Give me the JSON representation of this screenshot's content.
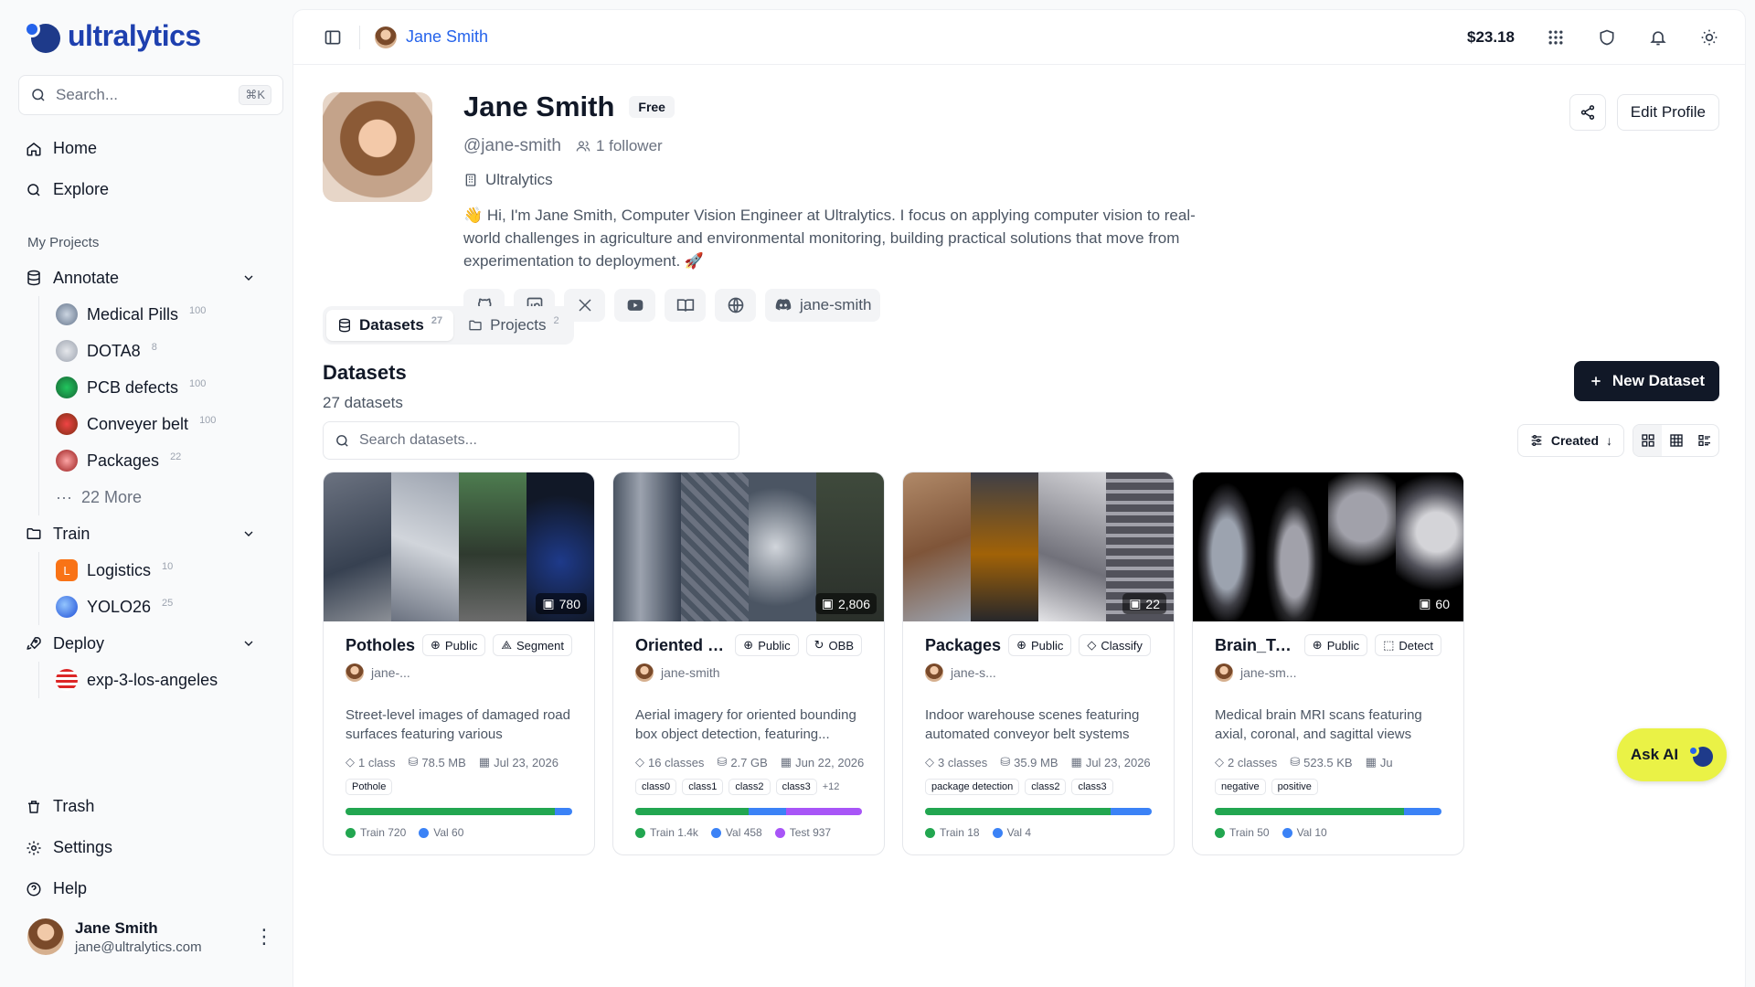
{
  "app": {
    "logo_text": "ultralytics",
    "brand_color": "#1e40af",
    "accent_color": "#2563eb"
  },
  "sidebar": {
    "search_placeholder": "Search...",
    "search_shortcut": "⌘K",
    "nav": [
      {
        "label": "Home",
        "icon": "home-icon"
      },
      {
        "label": "Explore",
        "icon": "search-icon"
      }
    ],
    "section_label": "My Projects",
    "groups": [
      {
        "label": "Annotate",
        "icon": "database-icon",
        "items": [
          {
            "label": "Medical Pills",
            "count": "100"
          },
          {
            "label": "DOTA8",
            "count": "8"
          },
          {
            "label": "PCB defects",
            "count": "100"
          },
          {
            "label": "Conveyer belt",
            "count": "100"
          },
          {
            "label": "Packages",
            "count": "22"
          }
        ],
        "more": "22 More"
      },
      {
        "label": "Train",
        "icon": "folder-icon",
        "items": [
          {
            "label": "Logistics",
            "count": "10"
          },
          {
            "label": "YOLO26",
            "count": "25"
          }
        ]
      },
      {
        "label": "Deploy",
        "icon": "rocket-icon",
        "items": [
          {
            "label": "exp-3-los-angeles",
            "count": ""
          }
        ]
      }
    ],
    "bottom": [
      {
        "label": "Trash"
      },
      {
        "label": "Settings"
      },
      {
        "label": "Help"
      }
    ],
    "user": {
      "name": "Jane Smith",
      "email": "jane@ultralytics.com"
    }
  },
  "topbar": {
    "crumb": "Jane Smith",
    "credit": "$23.18"
  },
  "profile": {
    "name": "Jane Smith",
    "plan": "Free",
    "handle": "@jane-smith",
    "followers": "1 follower",
    "org": "Ultralytics",
    "bio": "👋 Hi, I'm Jane Smith, Computer Vision Engineer at Ultralytics. I focus on applying computer vision to real-world challenges in agriculture and environmental monitoring, building practical solutions that move from experimentation to deployment. 🚀",
    "discord": "jane-smith",
    "edit_label": "Edit Profile"
  },
  "tabs": [
    {
      "label": "Datasets",
      "count": "27"
    },
    {
      "label": "Projects",
      "count": "2"
    }
  ],
  "datasets": {
    "title": "Datasets",
    "count": "27 datasets",
    "new_label": "New Dataset",
    "search_placeholder": "Search datasets...",
    "sort_label": "Created",
    "cards": [
      {
        "title": "Potholes",
        "visibility": "Public",
        "task": "Segment",
        "owner": "jane-...",
        "image_count": "780",
        "desc": "Street-level images of damaged road surfaces featuring various potholes,...",
        "classes_n": "1 class",
        "size": "78.5 MB",
        "date": "Jul 23, 2026",
        "classes": [
          "Pothole"
        ],
        "more": "",
        "legend": [
          {
            "label": "Train 720",
            "color": "#22a650"
          },
          {
            "label": "Val 60",
            "color": "#3b82f6"
          }
        ],
        "split": [
          720,
          60,
          0
        ]
      },
      {
        "title": "Oriented B...",
        "visibility": "Public",
        "task": "OBB",
        "owner": "jane-smith",
        "image_count": "2,806",
        "desc": "Aerial imagery for oriented bounding box object detection, featuring...",
        "classes_n": "16 classes",
        "size": "2.7 GB",
        "date": "Jun 22, 2026",
        "classes": [
          "class0",
          "class1",
          "class2",
          "class3"
        ],
        "more": "+12",
        "legend": [
          {
            "label": "Train 1.4k",
            "color": "#22a650"
          },
          {
            "label": "Val 458",
            "color": "#3b82f6"
          },
          {
            "label": "Test 937",
            "color": "#a855f7"
          }
        ],
        "split": [
          1400,
          458,
          937
        ]
      },
      {
        "title": "Packages",
        "visibility": "Public",
        "task": "Classify",
        "owner": "jane-s...",
        "image_count": "22",
        "desc": "Indoor warehouse scenes featuring automated conveyor belt systems fo...",
        "classes_n": "3 classes",
        "size": "35.9 MB",
        "date": "Jul 23, 2026",
        "classes": [
          "package detection",
          "class2",
          "class3"
        ],
        "more": "",
        "legend": [
          {
            "label": "Train 18",
            "color": "#22a650"
          },
          {
            "label": "Val 4",
            "color": "#3b82f6"
          }
        ],
        "split": [
          18,
          4,
          0
        ]
      },
      {
        "title": "Brain_Tu...",
        "visibility": "Public",
        "task": "Detect",
        "owner": "jane-sm...",
        "image_count": "60",
        "desc": "Medical brain MRI scans featuring axial, coronal, and sagittal views for...",
        "classes_n": "2 classes",
        "size": "523.5 KB",
        "date": "Ju",
        "classes": [
          "negative",
          "positive"
        ],
        "more": "",
        "legend": [
          {
            "label": "Train 50",
            "color": "#22a650"
          },
          {
            "label": "Val 10",
            "color": "#3b82f6"
          }
        ],
        "split": [
          50,
          10,
          0
        ]
      }
    ]
  },
  "ask_ai": "Ask AI"
}
